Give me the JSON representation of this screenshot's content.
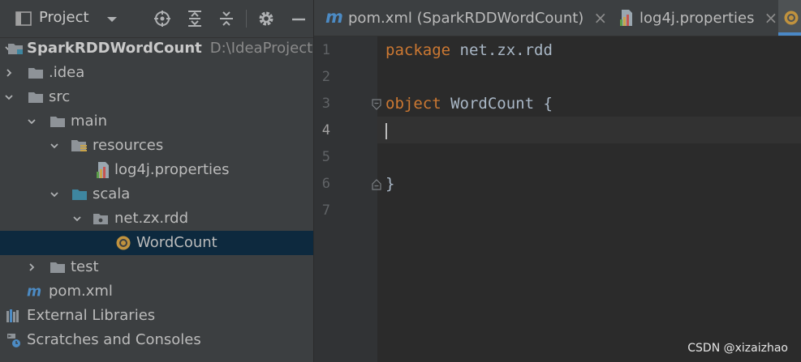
{
  "project_panel": {
    "view_label": "Project",
    "toolbar_icons": [
      "chevron-down-icon",
      "locate-icon",
      "expand-all-icon",
      "collapse-all-icon",
      "gear-icon",
      "minimize-icon"
    ],
    "tree": [
      {
        "label": "SparkRDDWordCount",
        "hint": "D:\\IdeaProjects\\S",
        "icon": "module-folder-icon",
        "arrow": "expanded",
        "depth": 0
      },
      {
        "label": ".idea",
        "icon": "folder-icon",
        "arrow": "collapsed",
        "depth": 1
      },
      {
        "label": "src",
        "icon": "folder-icon",
        "arrow": "expanded",
        "depth": 1
      },
      {
        "label": "main",
        "icon": "folder-icon",
        "arrow": "expanded",
        "depth": 2
      },
      {
        "label": "resources",
        "icon": "resources-folder-icon",
        "arrow": "expanded",
        "depth": 3
      },
      {
        "label": "log4j.properties",
        "icon": "properties-file-icon",
        "arrow": "none",
        "depth": 4
      },
      {
        "label": "scala",
        "icon": "source-folder-icon",
        "arrow": "expanded",
        "depth": 3
      },
      {
        "label": "net.zx.rdd",
        "icon": "package-icon",
        "arrow": "expanded",
        "depth": 4
      },
      {
        "label": "WordCount",
        "icon": "scala-object-icon",
        "arrow": "none",
        "depth": 5,
        "selected": true
      },
      {
        "label": "test",
        "icon": "folder-icon",
        "arrow": "collapsed",
        "depth": 2
      },
      {
        "label": "pom.xml",
        "icon": "maven-icon",
        "arrow": "none",
        "depth": 1
      },
      {
        "label": "External Libraries",
        "icon": "libraries-icon",
        "arrow": "none",
        "depth": 0
      },
      {
        "label": "Scratches and Consoles",
        "icon": "scratches-icon",
        "arrow": "none",
        "depth": 0
      }
    ]
  },
  "editor": {
    "tabs": [
      {
        "label": "pom.xml (SparkRDDWordCount)",
        "icon": "maven-icon",
        "close": "×"
      },
      {
        "label": "log4j.properties",
        "icon": "properties-file-icon",
        "close": "×"
      },
      {
        "label": "",
        "icon": "scala-object-icon",
        "close": "",
        "active": true
      }
    ],
    "line_numbers": [
      "1",
      "2",
      "3",
      "4",
      "5",
      "6",
      "7"
    ],
    "lines": [
      {
        "keyword": "package",
        "text": " net.zx.rdd"
      },
      {
        "keyword": "",
        "text": ""
      },
      {
        "keyword": "object",
        "text": " WordCount {"
      },
      {
        "keyword": "",
        "text": ""
      },
      {
        "keyword": "",
        "text": ""
      },
      {
        "keyword": "",
        "text": "}"
      },
      {
        "keyword": "",
        "text": ""
      }
    ],
    "caret_line": "4"
  },
  "watermark": "CSDN @xizaizhao",
  "colors": {
    "panel_bg": "#3c3f41",
    "editor_bg": "#2b2b2b",
    "selection": "#0d293e",
    "keyword": "#cc7832",
    "code_text": "#a9b7c6",
    "folder": "#8e9398",
    "source_folder": "#3e86a0",
    "scala_object": "#c0923e",
    "maven": "#4c8bc4"
  }
}
